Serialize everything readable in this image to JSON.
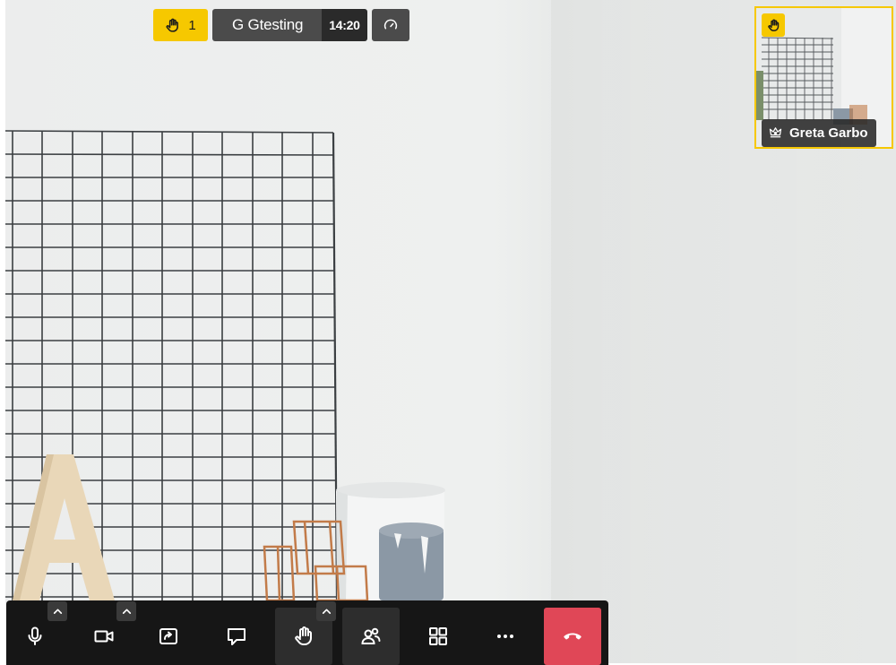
{
  "top_bar": {
    "raised_hands_count": "1",
    "raised_hands_icon": "raised-hand-icon",
    "meeting_name": "G Gtesting",
    "elapsed_time": "14:20",
    "connection_icon": "gauge-icon"
  },
  "self_view": {
    "participant_name": "Greta Garbo",
    "role_icon": "moderator-crown-icon",
    "hand_icon": "raised-hand-icon",
    "hand_raised": true
  },
  "toolbar": {
    "buttons": [
      {
        "name": "microphone",
        "icon": "microphone-icon",
        "has_options": true
      },
      {
        "name": "camera",
        "icon": "camera-icon",
        "has_options": true
      },
      {
        "name": "share-screen",
        "icon": "screen-share-icon",
        "has_options": false
      },
      {
        "name": "chat",
        "icon": "chat-icon",
        "has_options": false
      },
      {
        "name": "raise-hand",
        "icon": "raised-hand-icon",
        "has_options": true,
        "active": true
      },
      {
        "name": "participants",
        "icon": "participants-icon",
        "has_options": false,
        "active": true
      },
      {
        "name": "tile-view",
        "icon": "grid-icon",
        "has_options": false
      },
      {
        "name": "more-actions",
        "icon": "more-icon",
        "has_options": false
      },
      {
        "name": "leave-meeting",
        "icon": "hang-up-icon",
        "has_options": false
      }
    ]
  },
  "colors": {
    "accent_yellow": "#f6c800",
    "hangup_red": "#e04757",
    "toolbar_bg": "#161616",
    "label_bg": "#4b4b4b"
  }
}
